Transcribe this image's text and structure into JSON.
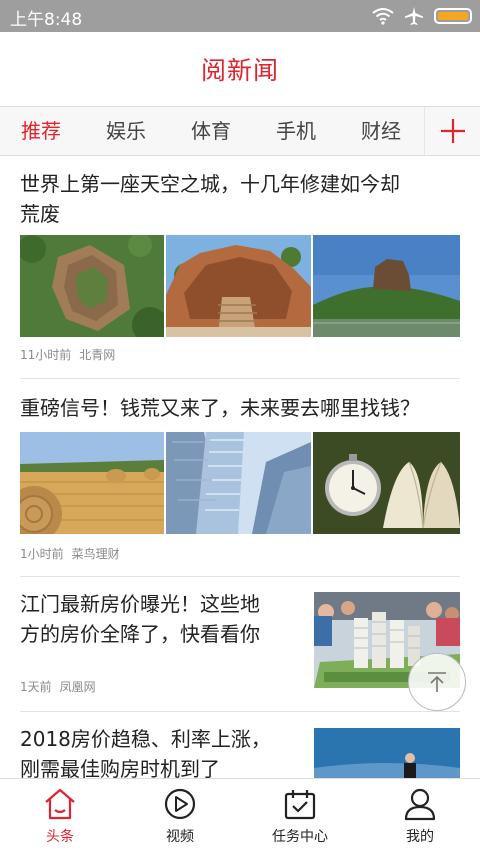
{
  "status_bar": {
    "time": "上午8:48"
  },
  "header": {
    "title": "阅新闻"
  },
  "tabs": [
    {
      "label": "推荐",
      "active": true
    },
    {
      "label": "娱乐",
      "active": false
    },
    {
      "label": "体育",
      "active": false
    },
    {
      "label": "手机",
      "active": false
    },
    {
      "label": "财经",
      "active": false
    }
  ],
  "tab_add_icon": "plus-icon",
  "articles": [
    {
      "title_lines": [
        "世界上第一座天空之城，十几年修建如今却",
        "荒废"
      ],
      "time": "11小时前",
      "source": "北青网",
      "images": [
        "aerial-rock-fortress",
        "rock-ruins-stairs",
        "rock-mountain-lake"
      ]
    },
    {
      "title_lines": [
        "重磅信号！钱荒又来了，未来要去哪里找钱？"
      ],
      "time": "1小时前",
      "source": "菜鸟理财",
      "images": [
        "hay-bales-field",
        "glass-skyscrapers",
        "pocket-watch-book"
      ]
    },
    {
      "title_lines": [
        "江门最新房价曝光！这些地",
        "方的房价全降了，快看看你"
      ],
      "time": "1天前",
      "source": "凤凰网",
      "images": [
        "real-estate-model"
      ]
    },
    {
      "title_lines": [
        "2018房价趋稳、利率上涨，",
        "刚需最佳购房时机到了"
      ],
      "images": [
        "businessman-sky"
      ]
    }
  ],
  "back_to_top_icon": "arrow-up-icon",
  "bottom_nav": [
    {
      "label": "头条",
      "icon": "home-icon",
      "active": true
    },
    {
      "label": "视频",
      "icon": "play-icon",
      "active": false
    },
    {
      "label": "任务中心",
      "icon": "calendar-check-icon",
      "active": false
    },
    {
      "label": "我的",
      "icon": "user-icon",
      "active": false
    }
  ],
  "colors": {
    "accent": "#e0242f",
    "status_bar": "#9e9e9e",
    "battery": "#f5a623"
  }
}
